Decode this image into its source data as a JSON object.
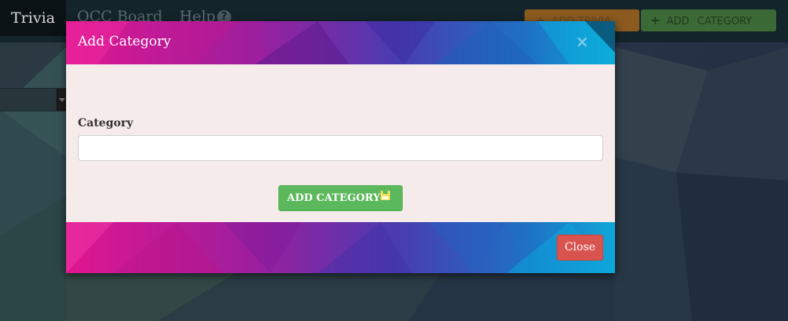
{
  "navbar": {
    "brand": "Trivia",
    "links": [
      "OCC Board",
      "Help"
    ],
    "help_badge": "?",
    "buttons": {
      "add_trivia": "ADD TRIVIA",
      "add_category": "ADD   CATEGORY",
      "plus_glyph": "+"
    }
  },
  "modal": {
    "title": "Add Category",
    "close_x": "×",
    "field_label": "Category",
    "field_value": "",
    "field_placeholder": "",
    "submit_label": "ADD CATEGORY",
    "close_label": "Close"
  },
  "colors": {
    "submit": "#5cb85c",
    "close": "#d9534f",
    "modal_body": "#f5ebea",
    "gradient_left": "#e0168f",
    "gradient_right": "#0fa8d8"
  },
  "icons": [
    "help-icon",
    "plus-icon",
    "save-icon",
    "close-icon"
  ]
}
